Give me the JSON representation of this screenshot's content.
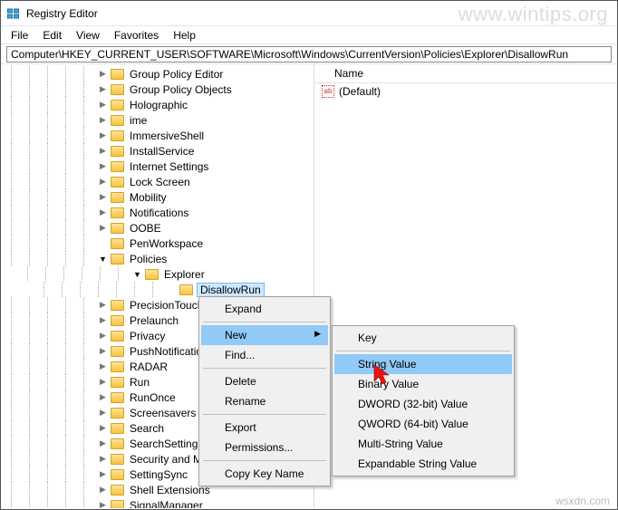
{
  "window": {
    "title": "Registry Editor"
  },
  "menubar": [
    "File",
    "Edit",
    "View",
    "Favorites",
    "Help"
  ],
  "addressbar": {
    "value": "Computer\\HKEY_CURRENT_USER\\SOFTWARE\\Microsoft\\Windows\\CurrentVersion\\Policies\\Explorer\\DisallowRun"
  },
  "list": {
    "header": "Name",
    "rows": [
      {
        "icon": "ab",
        "label": "(Default)"
      }
    ]
  },
  "tree": {
    "indent_start": 96,
    "items": [
      {
        "exp": ">",
        "label": "Group Policy Editor"
      },
      {
        "exp": ">",
        "label": "Group Policy Objects"
      },
      {
        "exp": ">",
        "label": "Holographic"
      },
      {
        "exp": ">",
        "label": "ime"
      },
      {
        "exp": ">",
        "label": "ImmersiveShell"
      },
      {
        "exp": ">",
        "label": "InstallService"
      },
      {
        "exp": ">",
        "label": "Internet Settings"
      },
      {
        "exp": ">",
        "label": "Lock Screen"
      },
      {
        "exp": ">",
        "label": "Mobility"
      },
      {
        "exp": ">",
        "label": "Notifications"
      },
      {
        "exp": ">",
        "label": "OOBE"
      },
      {
        "exp": " ",
        "label": "PenWorkspace"
      },
      {
        "exp": "v",
        "label": "Policies",
        "open": true
      },
      {
        "exp": "v",
        "label": "Explorer",
        "open": true,
        "indent": 1
      },
      {
        "exp": " ",
        "label": "DisallowRun",
        "indent": 2,
        "selected": true
      },
      {
        "exp": ">",
        "label": "PrecisionTouchPad"
      },
      {
        "exp": ">",
        "label": "Prelaunch"
      },
      {
        "exp": ">",
        "label": "Privacy"
      },
      {
        "exp": ">",
        "label": "PushNotifications"
      },
      {
        "exp": ">",
        "label": "RADAR"
      },
      {
        "exp": ">",
        "label": "Run"
      },
      {
        "exp": ">",
        "label": "RunOnce"
      },
      {
        "exp": ">",
        "label": "Screensavers"
      },
      {
        "exp": ">",
        "label": "Search"
      },
      {
        "exp": ">",
        "label": "SearchSettings"
      },
      {
        "exp": ">",
        "label": "Security and Maintenance"
      },
      {
        "exp": ">",
        "label": "SettingSync"
      },
      {
        "exp": ">",
        "label": "Shell Extensions"
      },
      {
        "exp": ">",
        "label": "SignalManager"
      }
    ]
  },
  "ctxmenu1": {
    "items": [
      {
        "label": "Expand",
        "type": "i"
      },
      {
        "type": "sep"
      },
      {
        "label": "New",
        "type": "i",
        "hl": true,
        "arrow": true
      },
      {
        "label": "Find...",
        "type": "i"
      },
      {
        "type": "sep"
      },
      {
        "label": "Delete",
        "type": "i"
      },
      {
        "label": "Rename",
        "type": "i"
      },
      {
        "type": "sep"
      },
      {
        "label": "Export",
        "type": "i"
      },
      {
        "label": "Permissions...",
        "type": "i"
      },
      {
        "type": "sep"
      },
      {
        "label": "Copy Key Name",
        "type": "i"
      }
    ]
  },
  "ctxmenu2": {
    "items": [
      {
        "label": "Key",
        "type": "i"
      },
      {
        "type": "sep"
      },
      {
        "label": "String Value",
        "type": "i",
        "hl": true
      },
      {
        "label": "Binary Value",
        "type": "i"
      },
      {
        "label": "DWORD (32-bit) Value",
        "type": "i"
      },
      {
        "label": "QWORD (64-bit) Value",
        "type": "i"
      },
      {
        "label": "Multi-String Value",
        "type": "i"
      },
      {
        "label": "Expandable String Value",
        "type": "i"
      }
    ]
  },
  "watermark": "www.wintips.org",
  "footmark": "wsxdn.com"
}
